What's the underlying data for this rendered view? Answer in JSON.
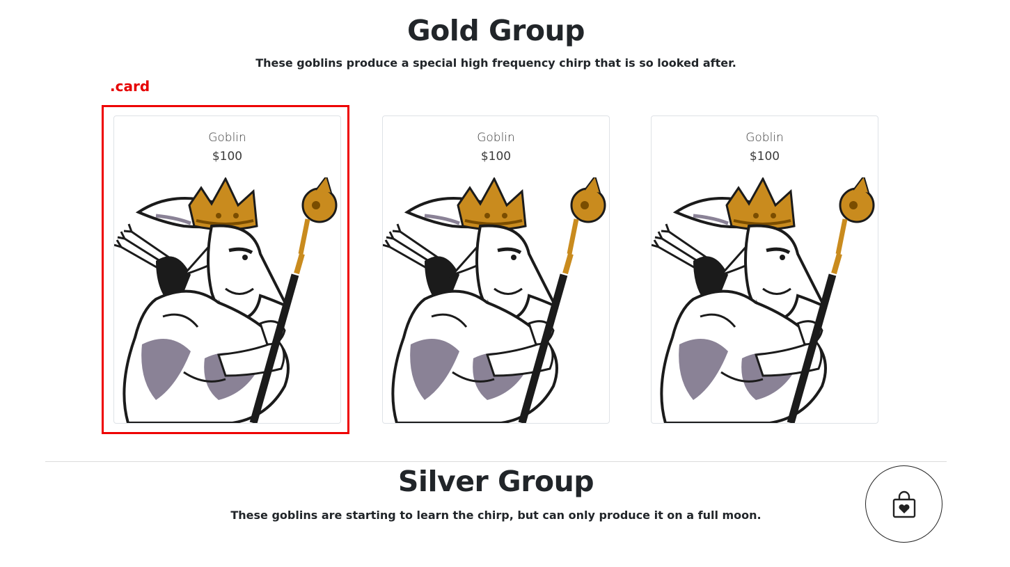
{
  "annotation": {
    "label": ".card",
    "color": "#ee0000"
  },
  "gold_group": {
    "title": "Gold Group",
    "description": "These goblins produce a special high frequency chirp that is so looked after."
  },
  "cards": [
    {
      "name": "Goblin",
      "price": "$100",
      "image_icon": "crowned-goblin-with-scepter"
    },
    {
      "name": "Goblin",
      "price": "$100",
      "image_icon": "crowned-goblin-with-scepter"
    },
    {
      "name": "Goblin",
      "price": "$100",
      "image_icon": "crowned-goblin-with-scepter"
    }
  ],
  "silver_group": {
    "title": "Silver Group",
    "description": "These goblins are starting to learn the chirp, but can only produce it on a full moon."
  },
  "cart": {
    "icon": "shopping-bag-heart-icon"
  },
  "colors": {
    "gold": "#c98b1e",
    "goblin_shade": "#8a8296",
    "ink": "#1b1b1b"
  }
}
